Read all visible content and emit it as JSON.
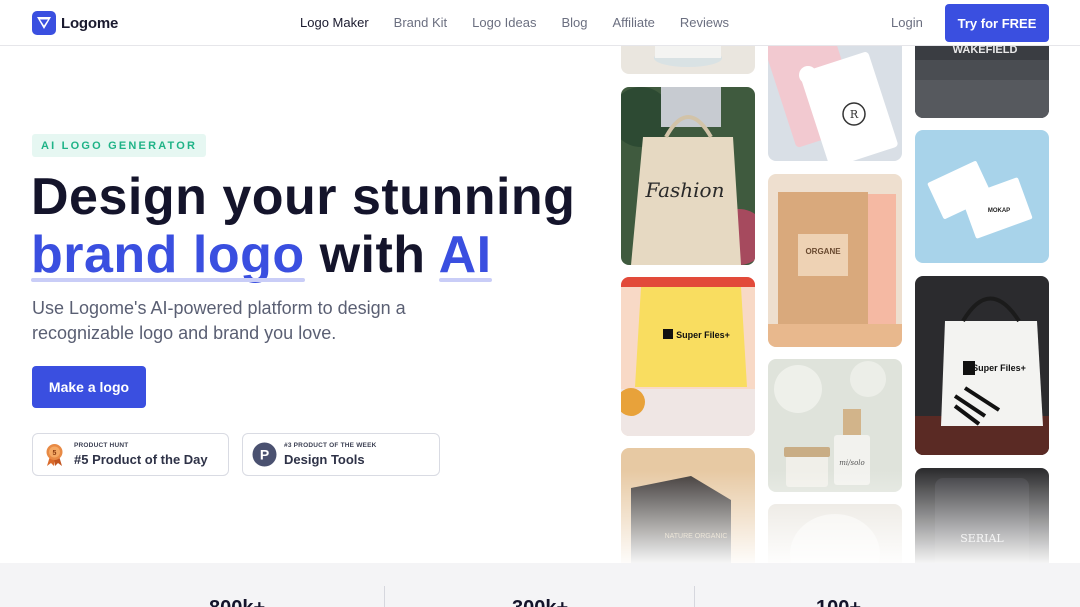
{
  "brand": {
    "name": "Logome",
    "accent": "#3a4fe0"
  },
  "nav": {
    "items": [
      "Logo Maker",
      "Brand Kit",
      "Logo Ideas",
      "Blog",
      "Affiliate",
      "Reviews"
    ],
    "login": "Login",
    "cta": "Try for FREE"
  },
  "hero": {
    "badge": "AI LOGO GENERATOR",
    "title_line1": "Design your stunning",
    "title_accent1": "brand logo",
    "title_mid": "with",
    "title_accent2": "AI",
    "subtitle": "Use Logome's AI-powered platform to design a recognizable logo and brand you love.",
    "cta": "Make a logo"
  },
  "awards": [
    {
      "label": "PRODUCT HUNT",
      "title": "#5 Product of the Day",
      "icon": "medal-icon"
    },
    {
      "label": "#3 PRODUCT OF THE WEEK",
      "title": "Design Tools",
      "icon": "producthunt-icon"
    }
  ],
  "gallery": {
    "mockups": [
      "WAKEFIELD",
      "Fashion",
      "Super Files+",
      "ORGANE",
      "MOKAP",
      "Super Files+",
      "NATURE ORGANIC",
      "mi/solo",
      "SERIAL"
    ]
  },
  "stats": [
    "800k+",
    "300k+",
    "100+"
  ]
}
